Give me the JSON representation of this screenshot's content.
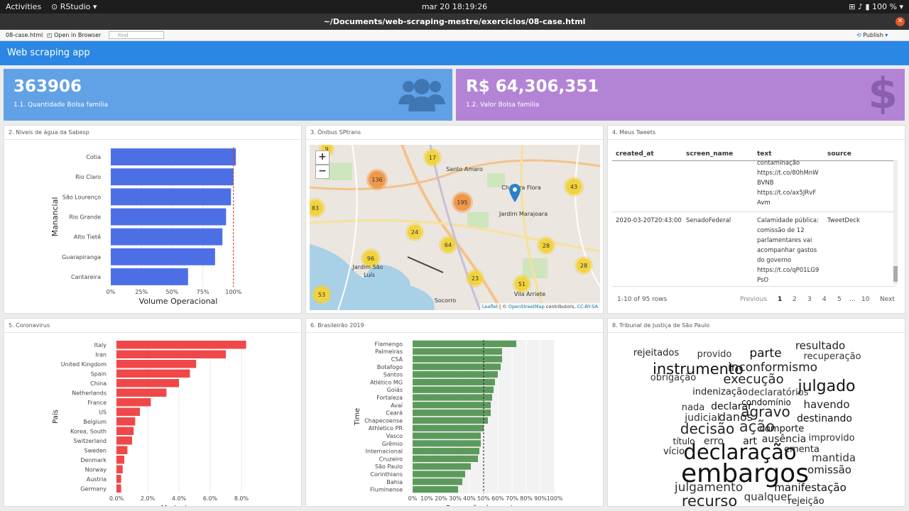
{
  "os": {
    "activities": "Activities",
    "app": "RStudio",
    "clock": "mar 20  18:19:26",
    "battery": "100 %"
  },
  "window": {
    "title": "~/Documents/web-scraping-mestre/exercicios/08-case.html"
  },
  "toolbar": {
    "file": "08-case.html",
    "open": "Open in Browser",
    "find": "Find",
    "publish": "Publish"
  },
  "navbar": {
    "title": "Web scraping app"
  },
  "vbox1": {
    "value": "363906",
    "caption": "1.1. Quantidade Bolsa familia"
  },
  "vbox2": {
    "value": "R$ 64,306,351",
    "caption": "1.2. Valor Bolsa familia"
  },
  "cards": {
    "c2": "2. Niveis de água da Sabesp",
    "c3": "3. Ônibus SPtrans",
    "c4": "4. Meus Tweets",
    "c5": "5. Coronavirus",
    "c6": "6. Brasileirão 2019",
    "c8": "8. Tribunal de Justiça de São Paulo"
  },
  "tweets": {
    "headers": [
      "created_at",
      "screen_name",
      "text",
      "source"
    ],
    "row1_text": [
      "contaminação",
      "https://t.co/80hMnW",
      "BVNB",
      "https://t.co/ax5JRvF",
      "Avm"
    ],
    "row2": {
      "created_at": "2020-03-20T20:43:00",
      "screen_name": "SenadoFederal",
      "source": "TweetDeck",
      "text": [
        "Calamidade pública:",
        "comissão de 12",
        "parlamentares vai",
        "acompanhar gastos",
        "do governo",
        "https://t.co/qP01LG9",
        "PsO"
      ]
    },
    "info": "1-10 of 95 rows",
    "prev": "Previous",
    "pages": [
      "1",
      "2",
      "3",
      "4",
      "5",
      "...",
      "10"
    ],
    "next": "Next"
  },
  "map": {
    "attribution_leaflet": "Leaflet",
    "attribution_mid": " | © ",
    "attribution_osm": "OpenStreetMap",
    "attribution_contrib": " contributors, ",
    "attribution_cc": "CC-BY-SA",
    "places": [
      "Santo Amaro",
      "Chácara Flora",
      "Jardim Marajoara",
      "Jardim São",
      "Luís",
      "Socorro",
      "Vila Arriete"
    ],
    "clusters": [
      {
        "n": "9",
        "c": "#f2d33e"
      },
      {
        "n": "17",
        "c": "#f2d33e"
      },
      {
        "n": "136",
        "c": "#f0984a"
      },
      {
        "n": "43",
        "c": "#f2d33e"
      },
      {
        "n": "83",
        "c": "#f2d33e"
      },
      {
        "n": "195",
        "c": "#f0984a"
      },
      {
        "n": "24",
        "c": "#f2d33e"
      },
      {
        "n": "64",
        "c": "#f2d33e"
      },
      {
        "n": "28",
        "c": "#f2d33e"
      },
      {
        "n": "96",
        "c": "#f2d33e"
      },
      {
        "n": "28",
        "c": "#f2d33e"
      },
      {
        "n": "23",
        "c": "#f2d33e"
      },
      {
        "n": "51",
        "c": "#f2d33e"
      },
      {
        "n": "53",
        "c": "#f2d33e"
      }
    ]
  },
  "chart_data": [
    {
      "type": "bar",
      "orientation": "horizontal",
      "categories": [
        "Cotia",
        "Rio Claro",
        "São Lourenço",
        "Rio Grande",
        "Alto Tietê",
        "Guarapiranga",
        "Cantareira"
      ],
      "values": [
        102,
        100,
        98,
        94,
        91,
        85,
        63
      ],
      "xlabel": "Volume Operacional",
      "ylabel": "Manancial",
      "xticks": [
        "0%",
        "25%",
        "50%",
        "75%",
        "100%"
      ],
      "xlim": [
        0,
        110
      ],
      "reference_line": 100,
      "color": "#4d6fe6"
    },
    {
      "type": "bar",
      "orientation": "horizontal",
      "categories": [
        "Italy",
        "Iran",
        "United Kingdom",
        "Spain",
        "China",
        "Netherlands",
        "France",
        "US",
        "Belgium",
        "Korea, South",
        "Switzerland",
        "Sweden",
        "Denmark",
        "Norway",
        "Austria",
        "Germany"
      ],
      "values": [
        8.3,
        7.0,
        5.1,
        4.7,
        4.0,
        3.2,
        2.2,
        1.5,
        1.2,
        1.1,
        1.0,
        0.7,
        0.5,
        0.4,
        0.3,
        0.3
      ],
      "xlabel": "Morte / caso",
      "ylabel": "País",
      "xticks": [
        "0.0%",
        "2.0%",
        "4.0%",
        "6.0%",
        "8.0%"
      ],
      "xlim": [
        0,
        8.5
      ],
      "color": "#f04848"
    },
    {
      "type": "bar",
      "orientation": "horizontal",
      "categories": [
        "Flamengo",
        "Palmeiras",
        "CSA",
        "Botafogo",
        "Santos",
        "Atlético MG",
        "Goiás",
        "Fortaleza",
        "Avaí",
        "Ceará",
        "Chapecoense",
        "Athletico PR",
        "Vasco",
        "Grêmio",
        "Internacional",
        "Cruzeiro",
        "São Paulo",
        "Corinthians",
        "Bahia",
        "Fluminense"
      ],
      "values": [
        73,
        63,
        63,
        62,
        60,
        58,
        57,
        56,
        55,
        55,
        53,
        50,
        48,
        48,
        47,
        46,
        41,
        37,
        35,
        32
      ],
      "xlabel": "Proporção de acertos",
      "ylabel": "Time",
      "xticks": [
        "0%",
        "10%",
        "20%",
        "30%",
        "40%",
        "50%",
        "60%",
        "70%",
        "80%",
        "90%",
        "100%"
      ],
      "xlim": [
        0,
        100
      ],
      "reference_line": 50,
      "color": "#5c9a5c"
    }
  ],
  "wordcloud": [
    "rejeitados",
    "provido",
    "parte",
    "resultado",
    "recuperação",
    "instrumento",
    "inconformismo",
    "obrigação",
    "execução",
    "julgado",
    "indenização",
    "declaratórios",
    "condomínio",
    "havendo",
    "nada",
    "declarar",
    "agravo",
    "judicial",
    "danos",
    "destinando",
    "decisão",
    "ação",
    "comporte",
    "título",
    "erro",
    "art",
    "ausência",
    "improvido",
    "vício",
    "declaração",
    "ementa",
    "mantida",
    "embargos",
    "omissão",
    "julgamento",
    "manifestação",
    "recurso",
    "qualquer",
    "rejeição"
  ]
}
